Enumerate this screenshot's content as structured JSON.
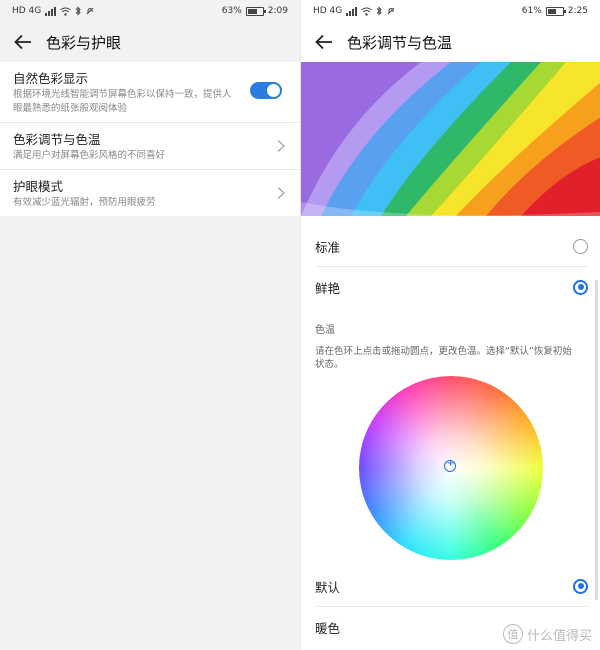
{
  "left": {
    "status": {
      "left_icons": "HD 4G",
      "battery": "63%",
      "battery_level": 0.63,
      "time": "2:09"
    },
    "header": {
      "title": "色彩与护眼"
    },
    "items": [
      {
        "title": "自然色彩显示",
        "subtitle": "根据环境光线智能调节屏幕色彩以保持一致，提供人眼最熟悉的纸张般观阅体验",
        "control": "toggle",
        "toggle_on": true
      },
      {
        "title": "色彩调节与色温",
        "subtitle": "满足用户对屏幕色彩风格的不同喜好",
        "control": "chevron"
      },
      {
        "title": "护眼模式",
        "subtitle": "有效减少蓝光辐射，预防用眼疲劳",
        "control": "chevron"
      }
    ]
  },
  "right": {
    "status": {
      "left_icons": "HD 4G",
      "battery": "61%",
      "battery_level": 0.61,
      "time": "2:25"
    },
    "header": {
      "title": "色彩调节与色温"
    },
    "modes": [
      {
        "label": "标准",
        "selected": false
      },
      {
        "label": "鲜艳",
        "selected": true
      }
    ],
    "color_temp": {
      "label": "色温",
      "description": "请在色环上点击或拖动圆点，更改色温。选择“默认”恢复初始状态。"
    },
    "temp_options": [
      {
        "label": "默认",
        "selected": true
      },
      {
        "label": "暖色",
        "selected": false
      }
    ]
  },
  "watermark": {
    "text": "什么值得买",
    "icon_glyph": "值"
  },
  "colors": {
    "accent": "#1a73e8",
    "toggle": "#2a7ce0"
  }
}
